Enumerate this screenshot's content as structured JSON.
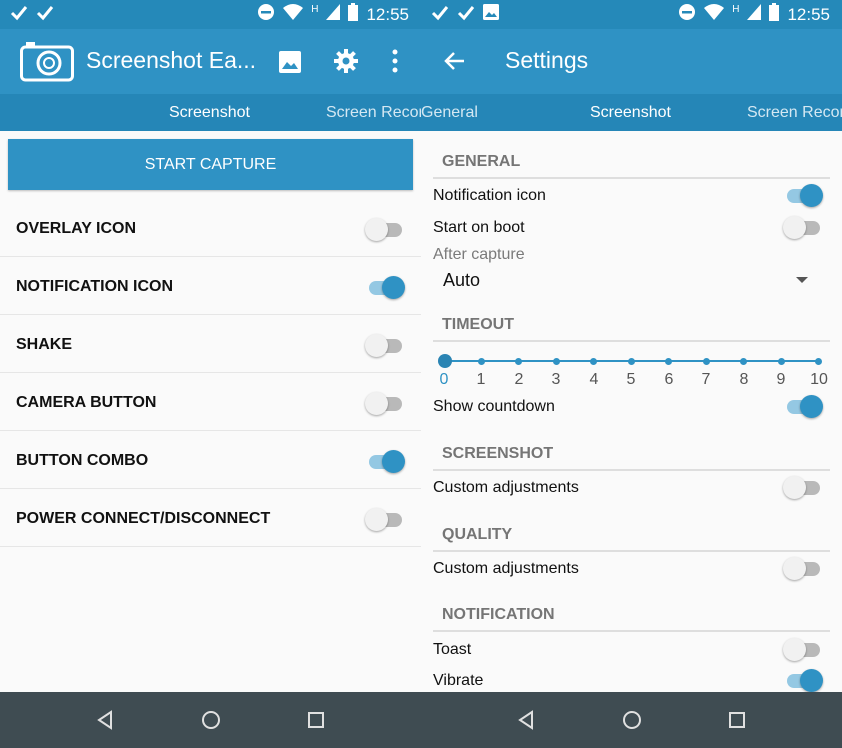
{
  "status_bar": {
    "time": "12:55",
    "network_indicator": "H",
    "left_icons": [
      "check-icon",
      "check-icon"
    ],
    "right_icons": [
      "do-not-disturb-icon",
      "wifi-icon",
      "signal-icon",
      "battery-icon"
    ]
  },
  "left": {
    "app_title": "Screenshot Ea...",
    "toolbar_icons": [
      "camera-logo-icon",
      "gallery-icon",
      "gear-icon",
      "more-vert-icon"
    ],
    "tabs": [
      {
        "label": "Screenshot",
        "selected": true
      },
      {
        "label": "Screen Recor",
        "selected": false
      }
    ],
    "start_button": "START CAPTURE",
    "options": [
      {
        "label": "OVERLAY ICON",
        "on": false
      },
      {
        "label": "NOTIFICATION ICON",
        "on": true
      },
      {
        "label": "SHAKE",
        "on": false
      },
      {
        "label": "CAMERA BUTTON",
        "on": false
      },
      {
        "label": "BUTTON COMBO",
        "on": true
      },
      {
        "label": "POWER CONNECT/DISCONNECT",
        "on": false
      }
    ]
  },
  "right": {
    "title": "Settings",
    "tabs": [
      {
        "label": "General",
        "selected": false
      },
      {
        "label": "Screenshot",
        "selected": true
      },
      {
        "label": "Screen Recor",
        "selected": false
      }
    ],
    "sections": {
      "general": "GENERAL",
      "timeout": "TIMEOUT",
      "screenshot": "SCREENSHOT",
      "quality": "QUALITY",
      "notification": "NOTIFICATION"
    },
    "notification_icon": {
      "label": "Notification icon",
      "on": true
    },
    "start_on_boot": {
      "label": "Start on boot",
      "on": false
    },
    "after_capture": {
      "label": "After capture",
      "value": "Auto"
    },
    "timeout_slider": {
      "ticks": [
        "0",
        "1",
        "2",
        "3",
        "4",
        "5",
        "6",
        "7",
        "8",
        "9",
        "10"
      ],
      "value": 0
    },
    "show_countdown": {
      "label": "Show countdown",
      "on": true
    },
    "screenshot_custom": {
      "label": "Custom adjustments",
      "on": false
    },
    "quality_custom": {
      "label": "Custom adjustments",
      "on": false
    },
    "toast": {
      "label": "Toast",
      "on": false
    },
    "vibrate": {
      "label": "Vibrate",
      "on": true
    }
  },
  "nav_icons": [
    "back-icon",
    "home-icon",
    "recents-icon"
  ],
  "colors": {
    "primary": "#2f92c4",
    "status_bar": "#2589b9",
    "tab_bar": "#2586b7",
    "nav_bar": "#3f4c52",
    "switch_track_on": "#94c8e3"
  }
}
